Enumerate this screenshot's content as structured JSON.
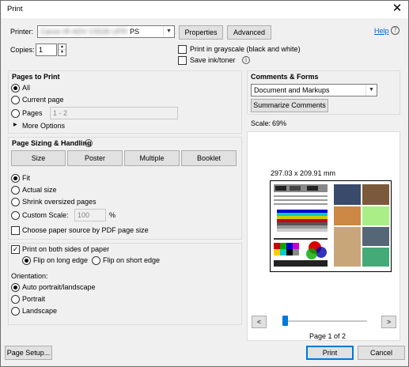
{
  "window": {
    "title": "Print",
    "close_glyph": "✕"
  },
  "printer": {
    "label": "Printer:",
    "name_blurred": "Canon iR-ADV C5535 UFR II",
    "name_suffix": "PS",
    "properties_label": "Properties",
    "advanced_label": "Advanced",
    "help_label": "Help",
    "help_icon": "?"
  },
  "copies": {
    "label": "Copies:",
    "value": "1"
  },
  "options": {
    "grayscale_label": "Print in grayscale (black and white)",
    "grayscale_checked": false,
    "save_ink_label": "Save ink/toner",
    "save_ink_checked": false,
    "info_icon": "i"
  },
  "pages_to_print": {
    "heading": "Pages to Print",
    "all_label": "All",
    "current_label": "Current page",
    "pages_label": "Pages",
    "pages_value": "1 - 2",
    "more_options_label": "More Options",
    "selected": "all"
  },
  "sizing": {
    "heading": "Page Sizing & Handling",
    "tabs": [
      "Size",
      "Poster",
      "Multiple",
      "Booklet"
    ],
    "fit_label": "Fit",
    "actual_label": "Actual size",
    "shrink_label": "Shrink oversized pages",
    "custom_label": "Custom Scale:",
    "custom_value": "100",
    "custom_unit": "%",
    "paper_source_label": "Choose paper source by PDF page size",
    "selected": "fit"
  },
  "duplex": {
    "both_sides_label": "Print on both sides of paper",
    "both_sides_checked": true,
    "long_edge_label": "Flip on long edge",
    "short_edge_label": "Flip on short edge",
    "selected": "long"
  },
  "orientation": {
    "heading": "Orientation:",
    "auto_label": "Auto portrait/landscape",
    "portrait_label": "Portrait",
    "landscape_label": "Landscape",
    "selected": "auto"
  },
  "comments": {
    "heading": "Comments & Forms",
    "value": "Document and Markups",
    "summarize_label": "Summarize Comments"
  },
  "preview": {
    "scale_label": "Scale:",
    "scale_value": "69%",
    "dimensions": "297.03 x 209.91 mm",
    "page_indicator": "Page 1 of 2",
    "prev_glyph": "<",
    "next_glyph": ">",
    "page_position": 0.0
  },
  "footer": {
    "page_setup_label": "Page Setup...",
    "print_label": "Print",
    "cancel_label": "Cancel"
  },
  "colors": {
    "accent": "#0078d7",
    "link": "#0066cc"
  }
}
